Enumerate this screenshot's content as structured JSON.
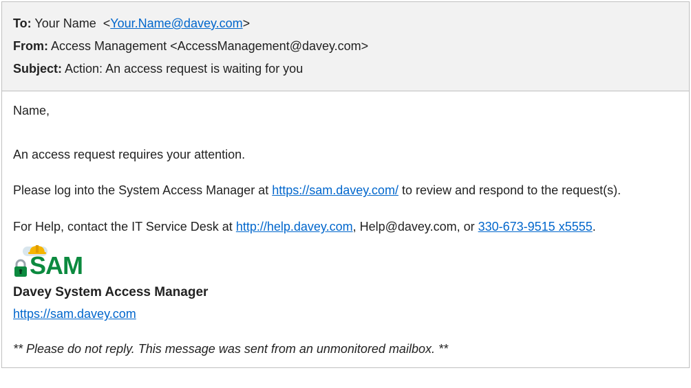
{
  "header": {
    "to_label": "To:",
    "to_name": "Your Name",
    "to_email": "Your.Name@davey.com",
    "from_label": "From:",
    "from_value": "Access Management <AccessManagement@davey.com>",
    "subject_label": "Subject:",
    "subject_value": "Action: An access request is waiting for you"
  },
  "body": {
    "greeting": "Name,",
    "line1": "An access request requires your attention.",
    "line2a": "Please log into the System Access Manager at ",
    "sam_url": "https://sam.davey.com/",
    "line2b": " to review and respond to the request(s).",
    "help_a": "For Help, contact the IT Service Desk at ",
    "help_url": "http://help.davey.com",
    "help_b": ", Help@davey.com, or ",
    "help_phone": "330-673-9515 x5555",
    "help_c": "."
  },
  "signature": {
    "logo_text": "SAM",
    "title": "Davey System Access Manager",
    "link": "https://sam.davey.com"
  },
  "disclaimer": "** Please do not reply.  This message was sent from an unmonitored mailbox. **"
}
